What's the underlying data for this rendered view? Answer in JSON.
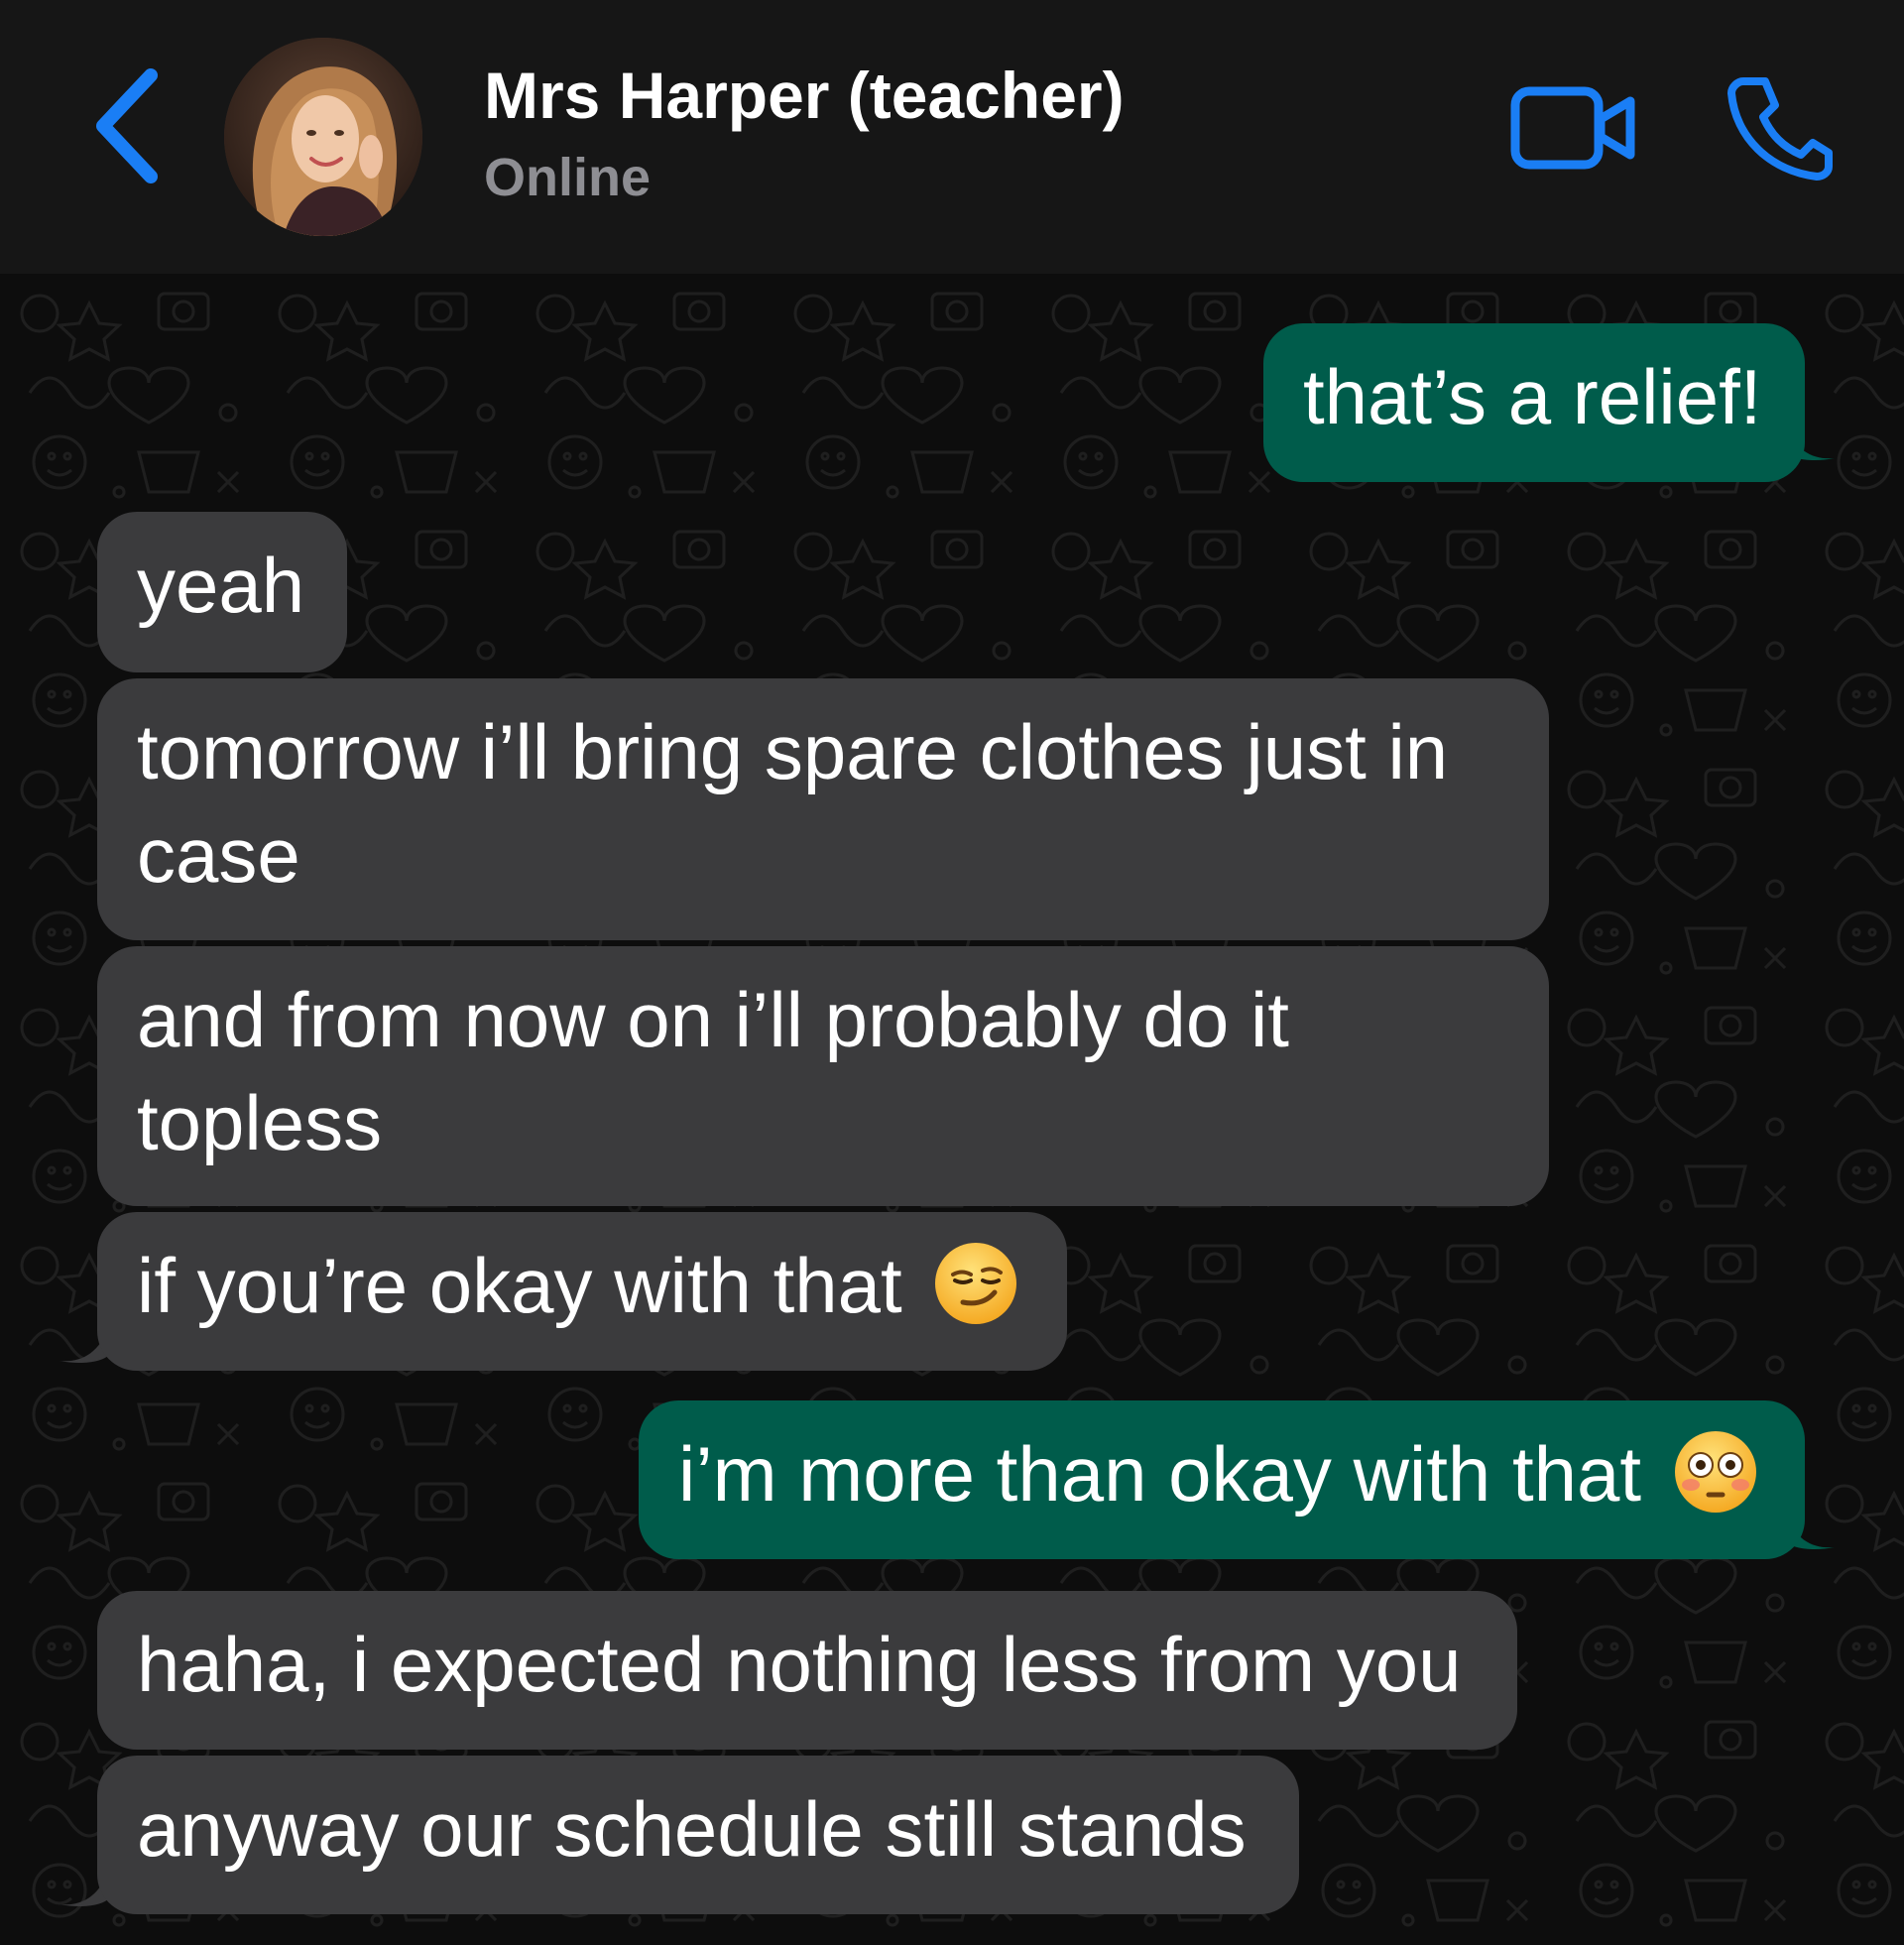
{
  "header": {
    "contact_name": "Mrs Harper (teacher)",
    "status": "Online"
  },
  "icons": {
    "back": "chevron-left-icon",
    "video": "video-camera-icon",
    "call": "phone-icon"
  },
  "colors": {
    "accent": "#1a7ef5",
    "header_bg": "#161616",
    "incoming_bubble": "#3b3b3d",
    "outgoing_bubble": "#005c4b",
    "status_text": "#8e8e93"
  },
  "messages": [
    {
      "direction": "outgoing",
      "text": "that’s a relief!"
    },
    {
      "direction": "incoming",
      "text": "yeah"
    },
    {
      "direction": "incoming",
      "text": "tomorrow i’ll bring spare clothes just in case"
    },
    {
      "direction": "incoming",
      "text": "and from now on i’ll probably do it topless"
    },
    {
      "direction": "incoming",
      "text": "if you’re okay with that",
      "emoji": "smirking-face"
    },
    {
      "direction": "outgoing",
      "text": "i’m more than okay with that",
      "emoji": "flushed-face"
    },
    {
      "direction": "incoming",
      "text": "haha, i expected nothing less from you"
    },
    {
      "direction": "incoming",
      "text": "anyway our schedule still stands"
    }
  ]
}
